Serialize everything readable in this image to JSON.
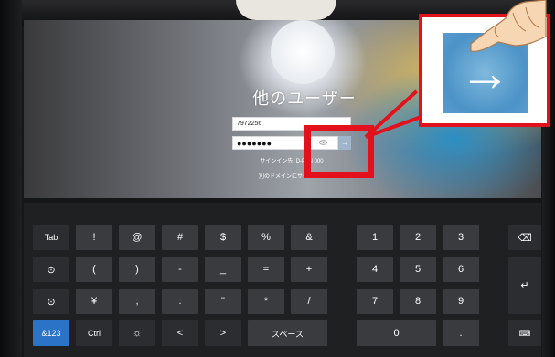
{
  "login": {
    "title": "他のユーザー",
    "username_value": "7972256",
    "password_value": "●●●●●●●",
    "reveal_icon": "eye-icon",
    "submit_glyph": "→",
    "signin_hint": "サインイン先: D-PAN   000",
    "other_domain_hint": "別のドメインにサインイン"
  },
  "callout": {
    "arrow_glyph": "→",
    "accent_color": "#e2111c"
  },
  "keyboard": {
    "row1": [
      "Tab",
      "!",
      "@",
      "#",
      "$",
      "%",
      "&",
      "1",
      "2",
      "3",
      "⌫"
    ],
    "row2": [
      "⊙",
      "(",
      ")",
      "-",
      "_",
      "=",
      "+",
      "4",
      "5",
      "6",
      "↵"
    ],
    "row3": [
      "⊙",
      "¥",
      ";",
      ":",
      "\"",
      "*",
      "/",
      "7",
      "8",
      "9"
    ],
    "row4": [
      "&123",
      "Ctrl",
      "☼",
      "<",
      ">",
      "スペース",
      "0",
      ".",
      "⌨"
    ]
  }
}
